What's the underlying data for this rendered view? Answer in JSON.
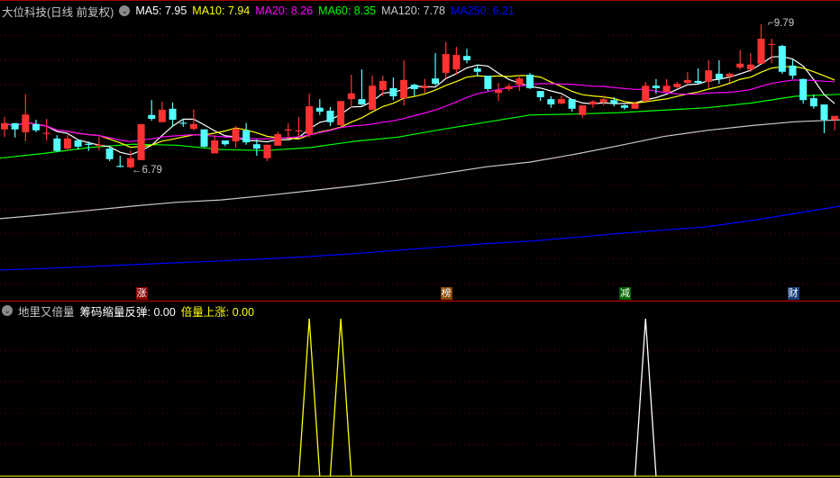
{
  "header": {
    "stock_title": "大位科技(日线 前复权)",
    "ma": [
      {
        "label": "MA5: 7.95",
        "color": "#ffffff"
      },
      {
        "label": "MA10: 7.94",
        "color": "#ffff00"
      },
      {
        "label": "MA20: 8.26",
        "color": "#ff00ff"
      },
      {
        "label": "MA60: 8.35",
        "color": "#00ff00"
      },
      {
        "label": "MA120: 7.78",
        "color": "#c8c8c8"
      },
      {
        "label": "MA250: 6.21",
        "color": "#0000ff"
      }
    ]
  },
  "annotations": {
    "high": "9.79",
    "low": "6.79"
  },
  "markers": [
    {
      "text": "涨",
      "candle": 13,
      "color": "#8b0000"
    },
    {
      "text": "榜",
      "candle": 42,
      "color": "#8b4500"
    },
    {
      "text": "减",
      "candle": 59,
      "color": "#006400"
    },
    {
      "text": "财",
      "candle": 75,
      "color": "#1a3f7a"
    }
  ],
  "indicator": {
    "name": "地里又倍量",
    "series1_label": "筹码缩量反弹: 0.00",
    "series2_label": "倍量上涨: 0.00",
    "series1_color": "#ffffff",
    "series2_color": "#ffff00"
  },
  "chart_data": {
    "type": "candlestick",
    "price_range": [
      6.79,
      9.79
    ],
    "ohlc": [
      [
        7.6,
        7.86,
        7.44,
        7.73
      ],
      [
        7.73,
        7.73,
        7.43,
        7.6
      ],
      [
        7.54,
        8.33,
        7.35,
        7.91
      ],
      [
        7.71,
        7.8,
        7.54,
        7.58
      ],
      [
        7.52,
        7.82,
        7.37,
        7.53
      ],
      [
        7.41,
        7.48,
        7.13,
        7.15
      ],
      [
        7.2,
        7.48,
        7.16,
        7.41
      ],
      [
        7.37,
        7.39,
        7.18,
        7.24
      ],
      [
        7.3,
        7.35,
        7.15,
        7.28
      ],
      [
        7.26,
        7.44,
        7.16,
        7.28
      ],
      [
        7.2,
        7.22,
        6.94,
        6.98
      ],
      [
        6.84,
        7.05,
        6.81,
        6.83
      ],
      [
        6.81,
        7.16,
        6.79,
        7.0
      ],
      [
        6.96,
        7.71,
        6.96,
        7.71
      ],
      [
        7.9,
        8.21,
        7.78,
        7.82
      ],
      [
        7.75,
        8.18,
        7.75,
        8.01
      ],
      [
        8.03,
        8.16,
        7.67,
        7.8
      ],
      [
        7.74,
        7.82,
        7.65,
        7.72
      ],
      [
        7.61,
        8.01,
        7.58,
        7.71
      ],
      [
        7.6,
        7.6,
        7.22,
        7.24
      ],
      [
        7.1,
        7.48,
        7.1,
        7.37
      ],
      [
        7.37,
        7.37,
        7.25,
        7.29
      ],
      [
        7.35,
        7.67,
        7.22,
        7.61
      ],
      [
        7.58,
        7.73,
        7.28,
        7.33
      ],
      [
        7.29,
        7.39,
        7.05,
        7.2
      ],
      [
        7.0,
        7.28,
        6.94,
        7.28
      ],
      [
        7.26,
        7.55,
        7.26,
        7.5
      ],
      [
        7.58,
        7.73,
        7.44,
        7.6
      ],
      [
        7.57,
        7.86,
        7.44,
        7.58
      ],
      [
        7.5,
        8.35,
        7.43,
        8.08
      ],
      [
        8.05,
        8.23,
        7.9,
        7.97
      ],
      [
        7.99,
        8.07,
        7.67,
        7.75
      ],
      [
        7.69,
        8.19,
        7.67,
        8.19
      ],
      [
        8.23,
        8.74,
        8.05,
        8.35
      ],
      [
        8.23,
        8.85,
        8.1,
        8.12
      ],
      [
        8.01,
        8.72,
        8.01,
        8.51
      ],
      [
        8.42,
        8.72,
        8.29,
        8.61
      ],
      [
        8.46,
        8.68,
        8.21,
        8.29
      ],
      [
        8.25,
        9.04,
        8.1,
        8.63
      ],
      [
        8.53,
        8.55,
        8.29,
        8.44
      ],
      [
        8.46,
        8.65,
        8.36,
        8.5
      ],
      [
        8.66,
        9.19,
        8.51,
        8.55
      ],
      [
        8.78,
        9.42,
        8.66,
        9.17
      ],
      [
        8.85,
        9.32,
        8.74,
        9.15
      ],
      [
        9.13,
        9.28,
        8.98,
        9.04
      ],
      [
        8.87,
        8.95,
        8.7,
        8.8
      ],
      [
        8.72,
        8.72,
        8.4,
        8.44
      ],
      [
        8.36,
        8.57,
        8.19,
        8.42
      ],
      [
        8.44,
        8.55,
        8.4,
        8.5
      ],
      [
        8.53,
        8.74,
        8.4,
        8.66
      ],
      [
        8.74,
        8.78,
        8.44,
        8.46
      ],
      [
        8.4,
        8.4,
        8.19,
        8.27
      ],
      [
        8.23,
        8.29,
        8.05,
        8.12
      ],
      [
        8.14,
        8.31,
        8.12,
        8.23
      ],
      [
        8.23,
        8.23,
        7.97,
        8.03
      ],
      [
        7.9,
        8.1,
        7.84,
        8.1
      ],
      [
        8.12,
        8.21,
        8.05,
        8.18
      ],
      [
        8.16,
        8.31,
        8.1,
        8.23
      ],
      [
        8.21,
        8.27,
        8.08,
        8.14
      ],
      [
        8.1,
        8.12,
        8.01,
        8.05
      ],
      [
        8.03,
        8.18,
        8.03,
        8.14
      ],
      [
        8.19,
        8.59,
        8.19,
        8.51
      ],
      [
        8.51,
        8.65,
        8.34,
        8.46
      ],
      [
        8.38,
        8.65,
        8.38,
        8.51
      ],
      [
        8.48,
        8.59,
        8.46,
        8.55
      ],
      [
        8.57,
        8.8,
        8.53,
        8.63
      ],
      [
        8.61,
        8.87,
        8.53,
        8.57
      ],
      [
        8.59,
        9.04,
        8.46,
        8.83
      ],
      [
        8.76,
        9.04,
        8.55,
        8.65
      ],
      [
        8.7,
        8.78,
        8.57,
        8.76
      ],
      [
        8.89,
        9.25,
        8.85,
        8.97
      ],
      [
        8.85,
        9.19,
        8.8,
        8.95
      ],
      [
        8.97,
        9.79,
        8.97,
        9.49
      ],
      [
        9.36,
        9.49,
        8.98,
        9.38
      ],
      [
        9.34,
        9.36,
        8.76,
        8.8
      ],
      [
        8.93,
        9.06,
        8.65,
        8.72
      ],
      [
        8.65,
        8.66,
        8.14,
        8.21
      ],
      [
        8.25,
        8.33,
        8.03,
        8.08
      ],
      [
        8.12,
        8.12,
        7.52,
        7.8
      ],
      [
        7.8,
        7.88,
        7.58,
        7.88
      ]
    ],
    "ma_long": {
      "MA60": [
        7.0,
        7.1,
        7.22,
        7.29,
        7.27,
        7.18,
        7.16,
        7.22,
        7.35,
        7.44,
        7.6,
        7.75,
        7.9,
        7.92,
        7.95,
        8.0,
        8.05,
        8.15,
        8.29,
        8.33
      ],
      "MA120": [
        5.74,
        5.82,
        5.91,
        6.0,
        6.08,
        6.13,
        6.22,
        6.32,
        6.42,
        6.54,
        6.68,
        6.82,
        6.92,
        7.08,
        7.26,
        7.45,
        7.58,
        7.68,
        7.76,
        7.8
      ],
      "MA250": [
        4.67,
        4.7,
        4.74,
        4.78,
        4.82,
        4.86,
        4.9,
        4.95,
        5.01,
        5.08,
        5.15,
        5.22,
        5.27,
        5.35,
        5.43,
        5.5,
        5.57,
        5.7,
        5.85,
        6.0
      ]
    },
    "indicator_series": {
      "倍量上涨": {
        "spikes_at_candle": [
          29,
          32
        ]
      },
      "筹码缩量反弹": {
        "spikes_at_candle": [
          61
        ]
      }
    }
  }
}
